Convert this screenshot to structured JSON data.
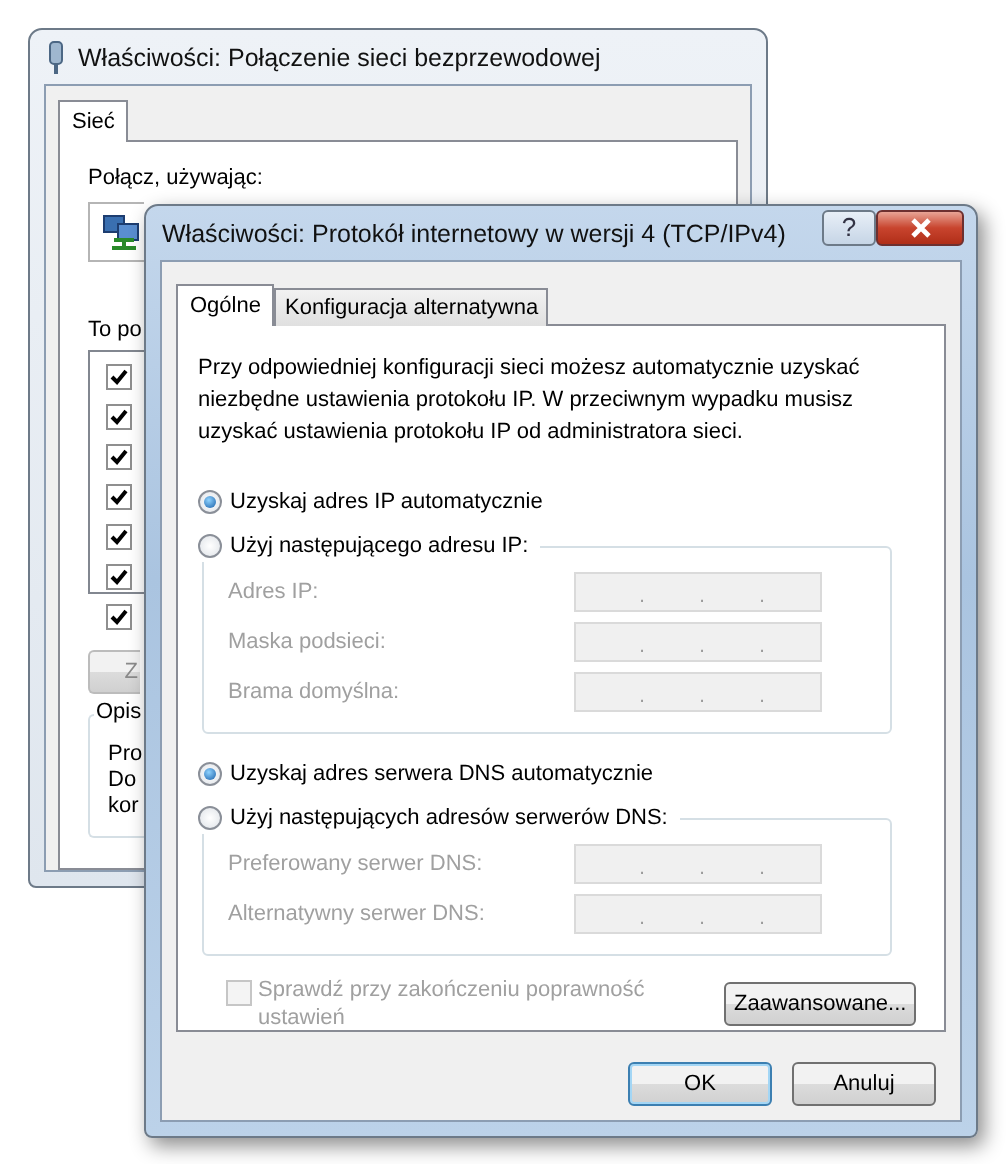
{
  "back_window": {
    "title": "Właściwości: Połączenie sieci bezprzewodowej",
    "tabs": [
      {
        "label": "Sieć",
        "selected": true
      }
    ],
    "connect_label": "Połącz, używając:",
    "components_label": "To po",
    "components": [
      {
        "checked": true
      },
      {
        "checked": true
      },
      {
        "checked": true
      },
      {
        "checked": true
      },
      {
        "checked": true
      },
      {
        "checked": true
      },
      {
        "checked": true
      }
    ],
    "button": "Z",
    "description_title": "Opis",
    "description_lines": [
      "Pro",
      "Do",
      "kor"
    ]
  },
  "front_window": {
    "title": "Właściwości: Protokół internetowy w wersji 4 (TCP/IPv4)",
    "help_button": "?",
    "tabs": [
      {
        "label": "Ogólne",
        "selected": true
      },
      {
        "label": "Konfiguracja alternatywna",
        "selected": false
      }
    ],
    "intro": "Przy odpowiedniej konfiguracji sieci możesz automatycznie uzyskać niezbędne ustawienia protokołu IP. W przeciwnym wypadku musisz uzyskać ustawienia protokołu IP od administratora sieci.",
    "sections": [
      {
        "auto_option": {
          "label": "Uzyskaj adres IP automatycznie",
          "selected": true
        },
        "manual_option": {
          "label": "Użyj następującego adresu IP:",
          "selected": false
        },
        "disabled": true,
        "fields": [
          {
            "label": "Adres IP:",
            "separators": [
              ".",
              ".",
              "."
            ]
          },
          {
            "label": "Maska podsieci:",
            "separators": [
              ".",
              ".",
              "."
            ]
          },
          {
            "label": "Brama domyślna:",
            "separators": [
              ".",
              ".",
              "."
            ]
          }
        ]
      },
      {
        "auto_option": {
          "label": "Uzyskaj adres serwera DNS automatycznie",
          "selected": true
        },
        "manual_option": {
          "label": "Użyj następujących adresów serwerów DNS:",
          "selected": false
        },
        "disabled": true,
        "fields": [
          {
            "label": "Preferowany serwer DNS:",
            "separators": [
              ".",
              ".",
              "."
            ]
          },
          {
            "label": "Alternatywny serwer DNS:",
            "separators": [
              ".",
              ".",
              "."
            ]
          }
        ]
      }
    ],
    "validate_checkbox": {
      "label": "Sprawdź przy zakończeniu poprawność ustawień",
      "checked": false,
      "disabled": true
    },
    "advanced_button": "Zaawansowane...",
    "buttons": [
      {
        "label": "OK",
        "default": true
      },
      {
        "label": "Anuluj",
        "default": false
      }
    ]
  }
}
